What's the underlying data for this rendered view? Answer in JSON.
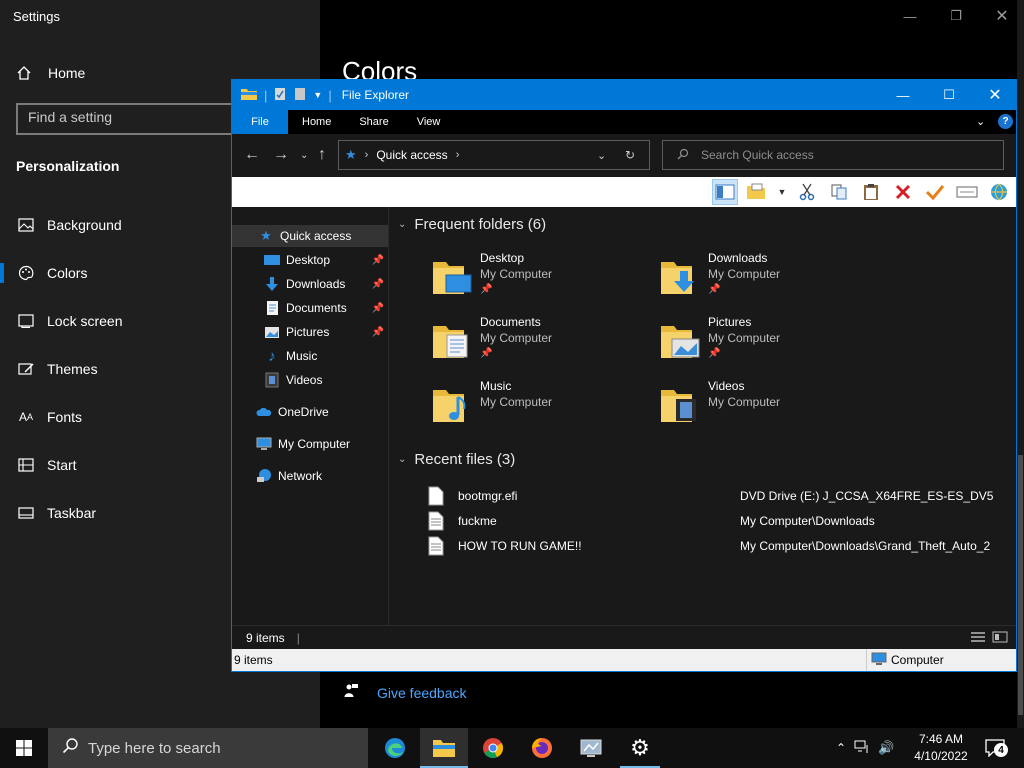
{
  "settings": {
    "title": "Settings",
    "home_label": "Home",
    "search_placeholder": "Find a setting",
    "section": "Personalization",
    "nav": [
      {
        "label": "Background",
        "icon": "picture-icon"
      },
      {
        "label": "Colors",
        "icon": "palette-icon",
        "active": true
      },
      {
        "label": "Lock screen",
        "icon": "lock-screen-icon"
      },
      {
        "label": "Themes",
        "icon": "themes-icon"
      },
      {
        "label": "Fonts",
        "icon": "fonts-icon"
      },
      {
        "label": "Start",
        "icon": "start-icon"
      },
      {
        "label": "Taskbar",
        "icon": "taskbar-icon"
      }
    ],
    "page_heading": "Colors",
    "feedback_label": "Give feedback"
  },
  "explorer": {
    "title": "File Explorer",
    "ribbon_tabs": [
      "File",
      "Home",
      "Share",
      "View"
    ],
    "address_path": "Quick access",
    "search_placeholder": "Search Quick access",
    "nav_pane": [
      {
        "label": "Quick access",
        "icon": "star-icon",
        "selected": true
      },
      {
        "label": "Desktop",
        "icon": "desktop-icon",
        "pinned": true
      },
      {
        "label": "Downloads",
        "icon": "download-icon",
        "pinned": true
      },
      {
        "label": "Documents",
        "icon": "document-icon",
        "pinned": true
      },
      {
        "label": "Pictures",
        "icon": "pictures-icon",
        "pinned": true
      },
      {
        "label": "Music",
        "icon": "music-icon"
      },
      {
        "label": "Videos",
        "icon": "videos-icon"
      },
      {
        "label": "OneDrive",
        "icon": "cloud-icon"
      },
      {
        "label": "My Computer",
        "icon": "computer-icon"
      },
      {
        "label": "Network",
        "icon": "network-icon"
      }
    ],
    "frequent_header": "Frequent folders (6)",
    "frequent_folders": [
      {
        "name": "Desktop",
        "location": "My Computer",
        "pinned": true
      },
      {
        "name": "Downloads",
        "location": "My Computer",
        "pinned": true
      },
      {
        "name": "Documents",
        "location": "My Computer",
        "pinned": true
      },
      {
        "name": "Pictures",
        "location": "My Computer",
        "pinned": true
      },
      {
        "name": "Music",
        "location": "My Computer"
      },
      {
        "name": "Videos",
        "location": "My Computer"
      }
    ],
    "recent_header": "Recent files (3)",
    "recent_files": [
      {
        "name": "bootmgr.efi",
        "path": "DVD Drive (E:) J_CCSA_X64FRE_ES-ES_DV5"
      },
      {
        "name": "fuckme",
        "path": "My Computer\\Downloads"
      },
      {
        "name": "HOW TO RUN GAME!!",
        "path": "My Computer\\Downloads\\Grand_Theft_Auto_2"
      }
    ],
    "status_items": "9 items",
    "status_bar_items": "9 items",
    "status_bar_location": "Computer"
  },
  "taskbar": {
    "search_placeholder": "Type here to search",
    "apps": [
      "edge-icon",
      "file-explorer-icon",
      "chrome-icon",
      "firefox-icon",
      "control-panel-icon",
      "settings-icon"
    ],
    "time": "7:46 AM",
    "date": "4/10/2022",
    "notification_count": "4"
  },
  "colors": {
    "accent": "#0078d7",
    "link": "#4ea6ff",
    "folder": "#f3c94c"
  }
}
